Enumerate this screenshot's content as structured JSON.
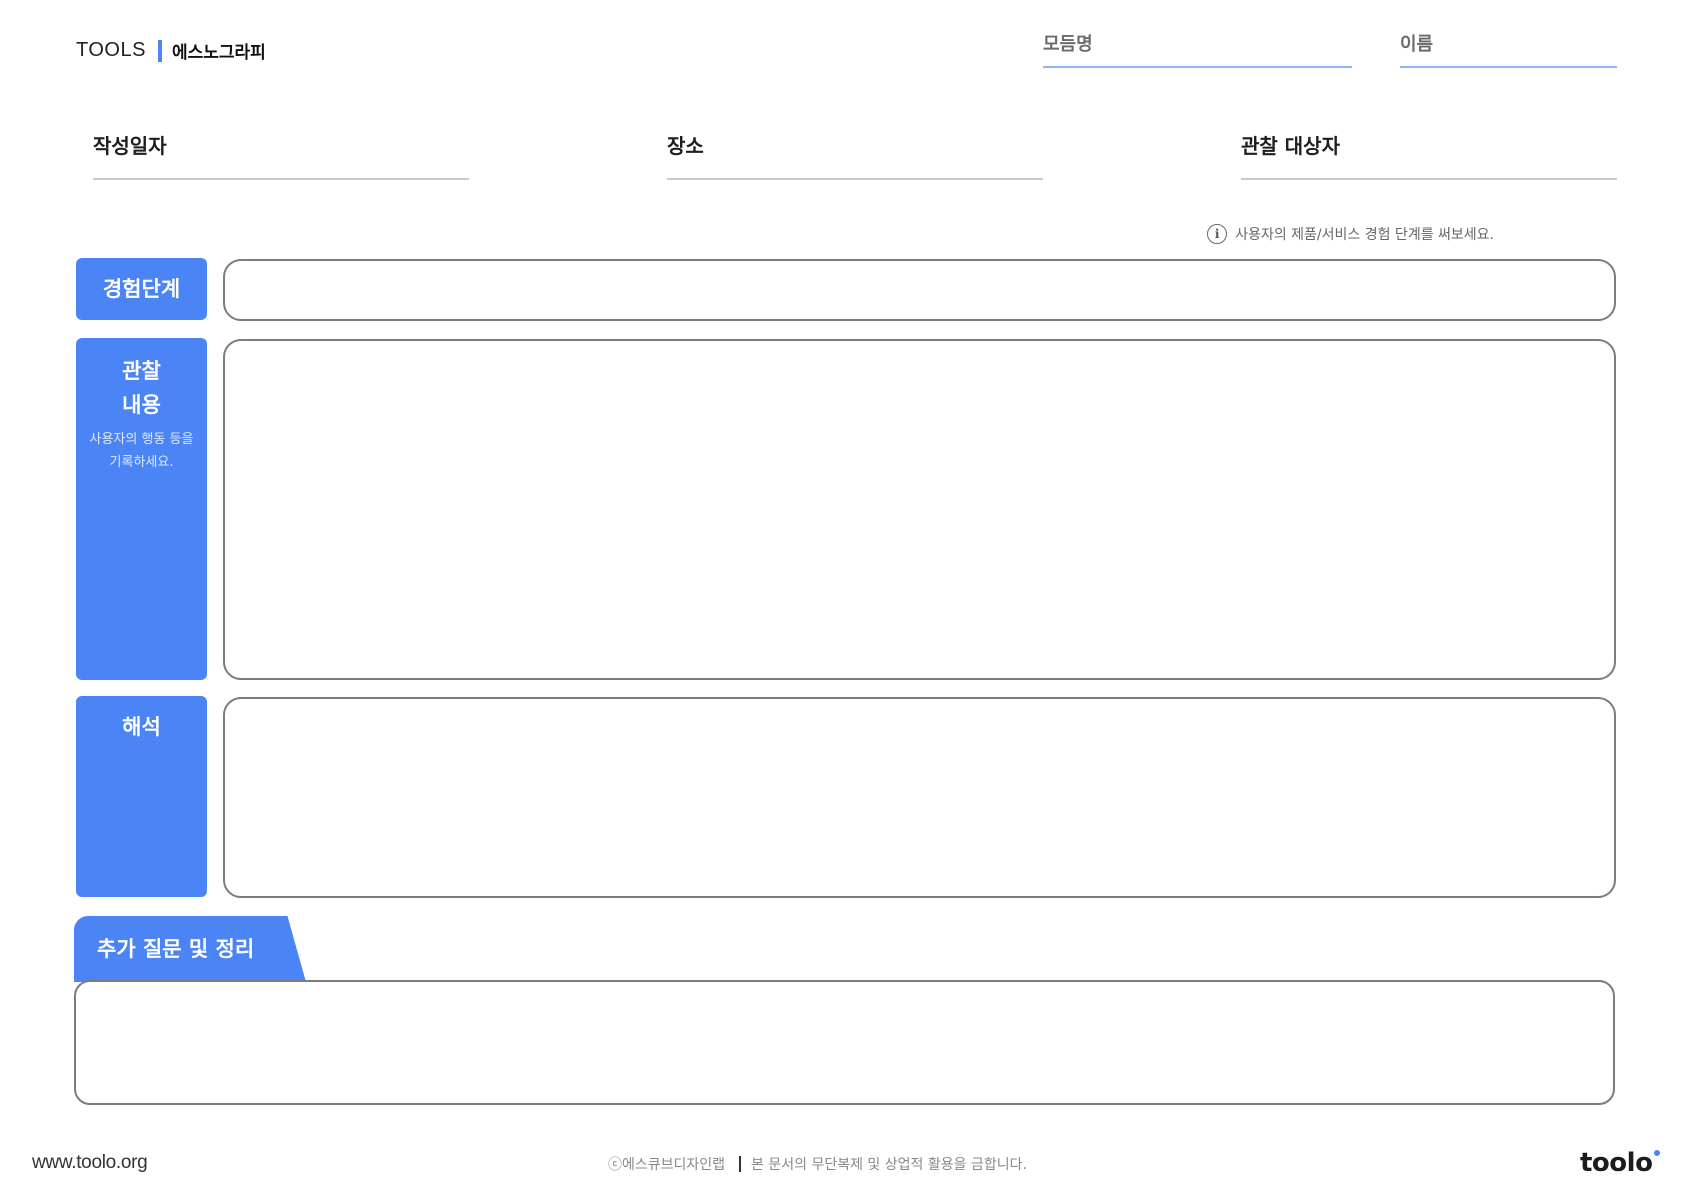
{
  "header": {
    "brand": "TOOLS",
    "title": "에스노그라피",
    "module_label": "모듬명",
    "name_label": "이름"
  },
  "info": {
    "date_label": "작성일자",
    "place_label": "장소",
    "subject_label": "관찰 대상자"
  },
  "hint": "사용자의 제품/서비스 경험 단계를 써보세요.",
  "sections": {
    "stage": {
      "title": "경험단계"
    },
    "observation": {
      "title_line1": "관찰",
      "title_line2": "내용",
      "sub_line1": "사용자의 행동 등을",
      "sub_line2": "기록하세요."
    },
    "interpretation": {
      "title": "해석"
    },
    "extra": {
      "title": "추가 질문 및 정리"
    }
  },
  "footer": {
    "url": "www.toolo.org",
    "copyright": "ⓒ에스큐브디자인랩",
    "notice": "본 문서의 무단복제 및 상업적 활용을 금합니다.",
    "logo": "toolo"
  },
  "colors": {
    "accent": "#4b84f5",
    "underline_meta": "#8fb3f8",
    "border": "#7c7c7c"
  }
}
